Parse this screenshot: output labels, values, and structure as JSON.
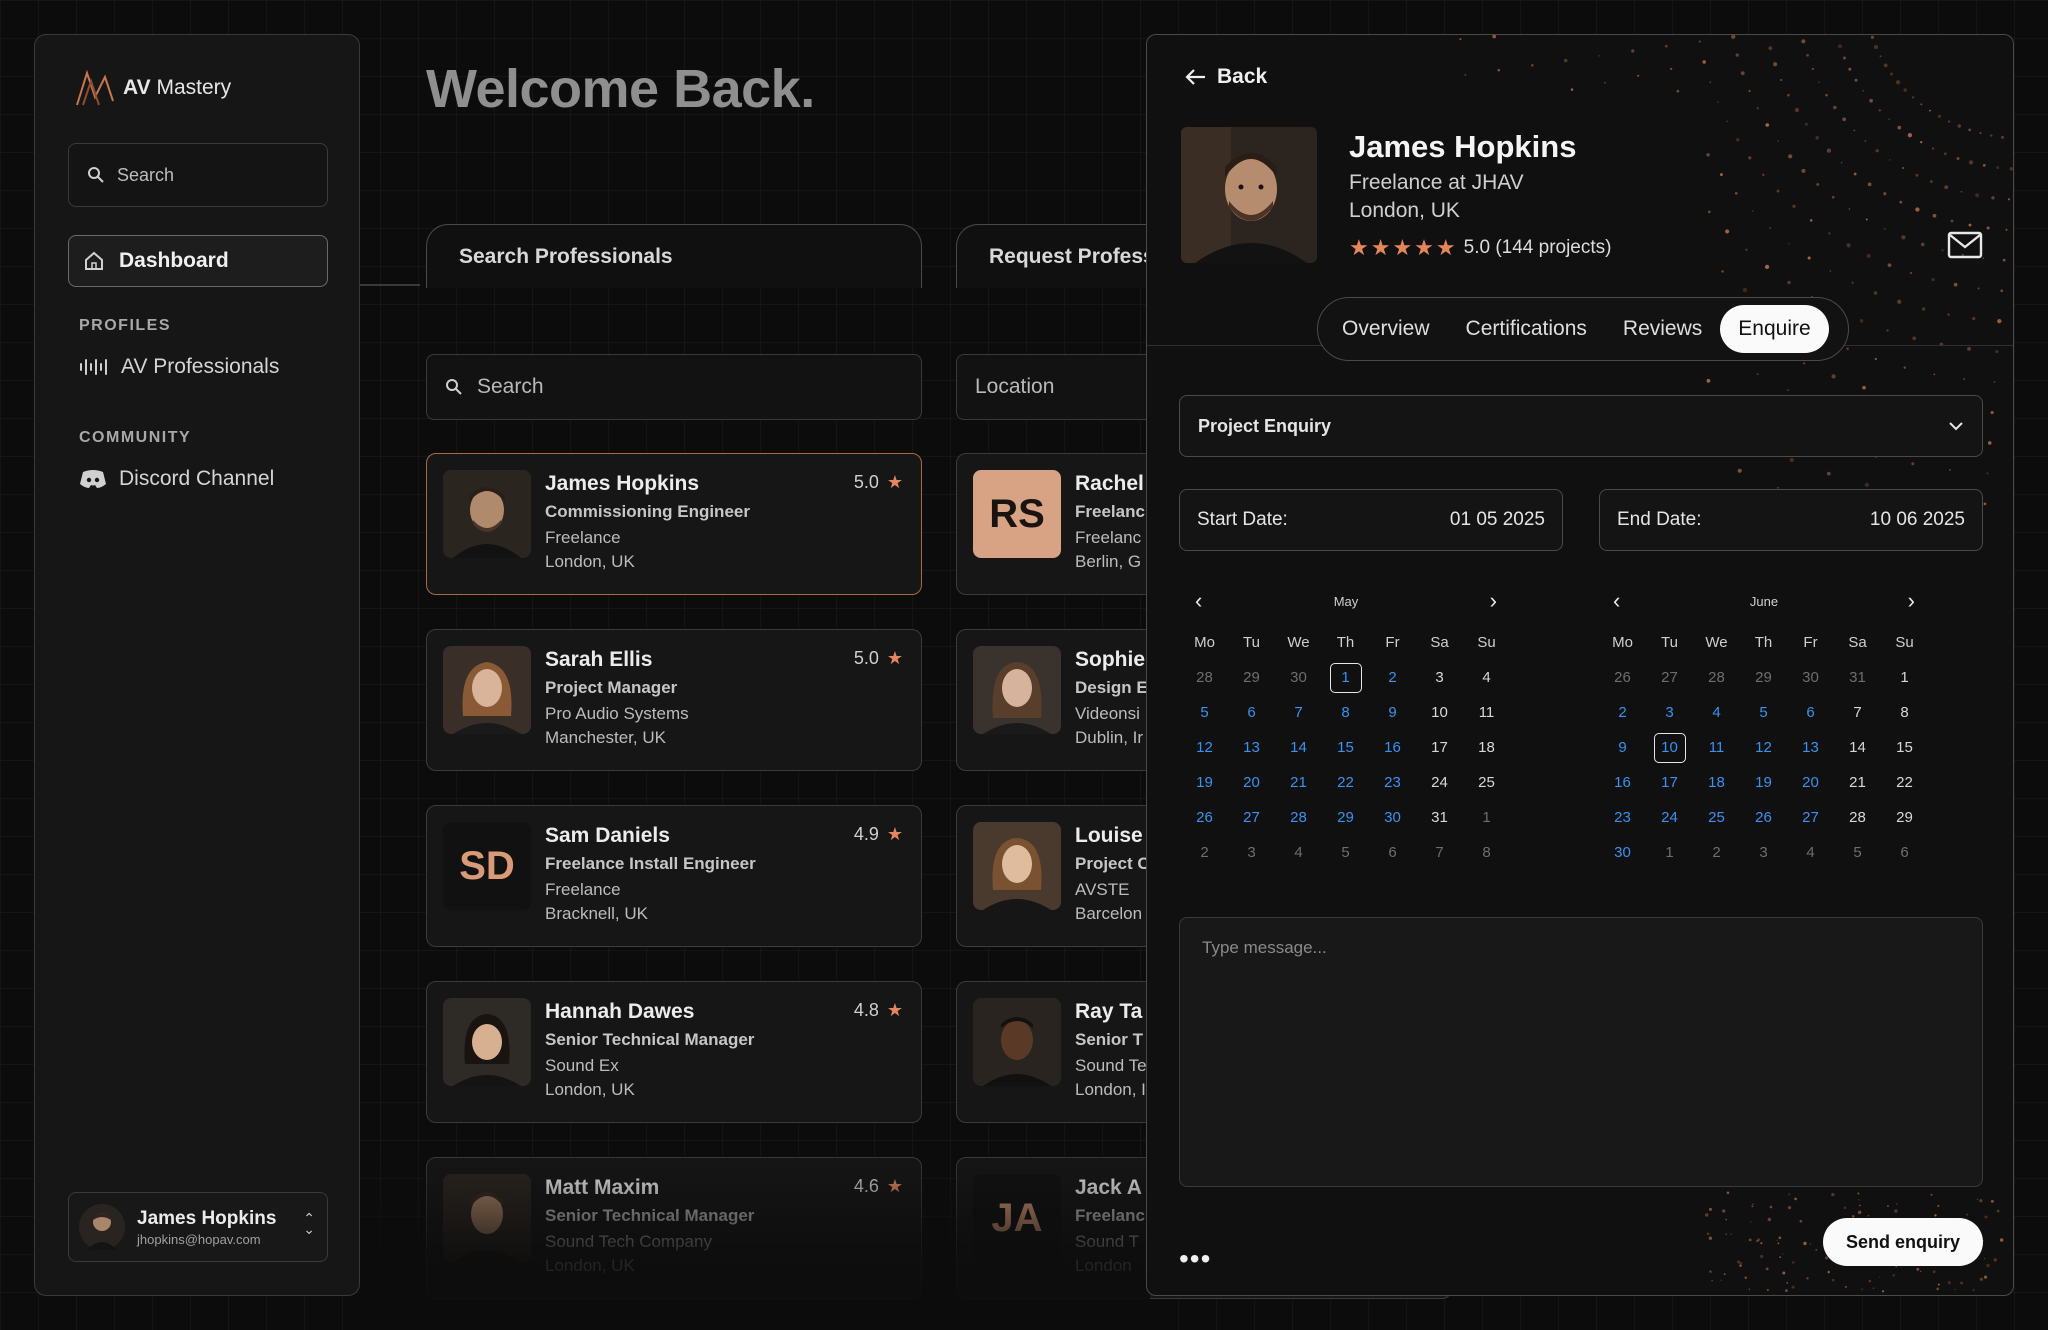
{
  "app": {
    "brand_bold": "AV",
    "brand_rest": "Mastery"
  },
  "sidebar": {
    "search_label": "Search",
    "dashboard_label": "Dashboard",
    "profiles_heading": "PROFILES",
    "av_professionals_label": "AV Professionals",
    "community_heading": "COMMUNITY",
    "discord_label": "Discord Channel",
    "user": {
      "name": "James Hopkins",
      "email": "jhopkins@hopav.com"
    }
  },
  "main": {
    "welcome": "Welcome Back.",
    "tabs": [
      "Search Professionals",
      "Request Profess"
    ],
    "search_placeholder": "Search",
    "location_placeholder": "Location",
    "cards_left": [
      {
        "name": "James Hopkins",
        "role": "Commissioning Engineer",
        "company": "Freelance",
        "location": "London, UK",
        "rating": "5.0"
      },
      {
        "name": "Sarah Ellis",
        "role": "Project Manager",
        "company": "Pro Audio Systems",
        "location": "Manchester, UK",
        "rating": "5.0"
      },
      {
        "name": "Sam Daniels",
        "initials": "SD",
        "role": "Freelance Install Engineer",
        "company": "Freelance",
        "location": "Bracknell, UK",
        "rating": "4.9"
      },
      {
        "name": "Hannah Dawes",
        "role": "Senior Technical Manager",
        "company": "Sound Ex",
        "location": "London, UK",
        "rating": "4.8"
      },
      {
        "name": "Matt Maxim",
        "role": "Senior Technical Manager",
        "company": "Sound Tech Company",
        "location": "London, UK",
        "rating": "4.6"
      }
    ],
    "cards_right": [
      {
        "name": "Rachel",
        "initials": "RS",
        "role": "Freelanc",
        "company": "Freelanc",
        "location": "Berlin, G"
      },
      {
        "name": "Sophie",
        "role": "Design E",
        "company": "Videonsi",
        "location": "Dublin, Ir"
      },
      {
        "name": "Louise",
        "role": "Project C",
        "company": "AVSTE",
        "location": "Barcelon"
      },
      {
        "name": "Ray Ta",
        "role": "Senior T",
        "company": "Sound Te",
        "location": "London, I"
      },
      {
        "name": "Jack A",
        "initials": "JA",
        "role": "Freelanc",
        "company": "Sound T",
        "location": "London"
      }
    ]
  },
  "profile": {
    "back_label": "Back",
    "name": "James Hopkins",
    "subtitle": "Freelance at JHAV",
    "location": "London, UK",
    "rating_text": "5.0 (144 projects)",
    "rating": 5,
    "tabs": [
      "Overview",
      "Certifications",
      "Reviews",
      "Enquire"
    ],
    "active_tab": "Enquire",
    "enquiry_type": "Project Enquiry",
    "start_label": "Start Date:",
    "start_value": "01 05 2025",
    "end_label": "End Date:",
    "end_value": "10 06 2025",
    "message_placeholder": "Type message...",
    "more_label": "•••",
    "send_label": "Send enquiry"
  },
  "calendars": [
    {
      "month": "May",
      "selected": "1",
      "days": [
        "28",
        "29",
        "30",
        "1",
        "2",
        "3",
        "4",
        "5",
        "6",
        "7",
        "8",
        "9",
        "10",
        "11",
        "12",
        "13",
        "14",
        "15",
        "16",
        "17",
        "18",
        "19",
        "20",
        "21",
        "22",
        "23",
        "24",
        "25",
        "26",
        "27",
        "28",
        "29",
        "30",
        "31",
        "1",
        "2",
        "3",
        "4",
        "5",
        "6",
        "7",
        "8"
      ]
    },
    {
      "month": "June",
      "selected": "10",
      "days": [
        "26",
        "27",
        "28",
        "29",
        "30",
        "31",
        "1",
        "2",
        "3",
        "4",
        "5",
        "6",
        "7",
        "8",
        "9",
        "10",
        "11",
        "12",
        "13",
        "14",
        "15",
        "16",
        "17",
        "18",
        "19",
        "20",
        "21",
        "22",
        "23",
        "24",
        "25",
        "26",
        "27",
        "28",
        "29",
        "30",
        "1",
        "2",
        "3",
        "4",
        "5",
        "6"
      ]
    }
  ],
  "weekdays": [
    "Mo",
    "Tu",
    "We",
    "Th",
    "Fr",
    "Sa",
    "Su"
  ],
  "colors": {
    "accent": "#e5865a",
    "link": "#3a91f0",
    "selected_border": "#a86a46"
  }
}
